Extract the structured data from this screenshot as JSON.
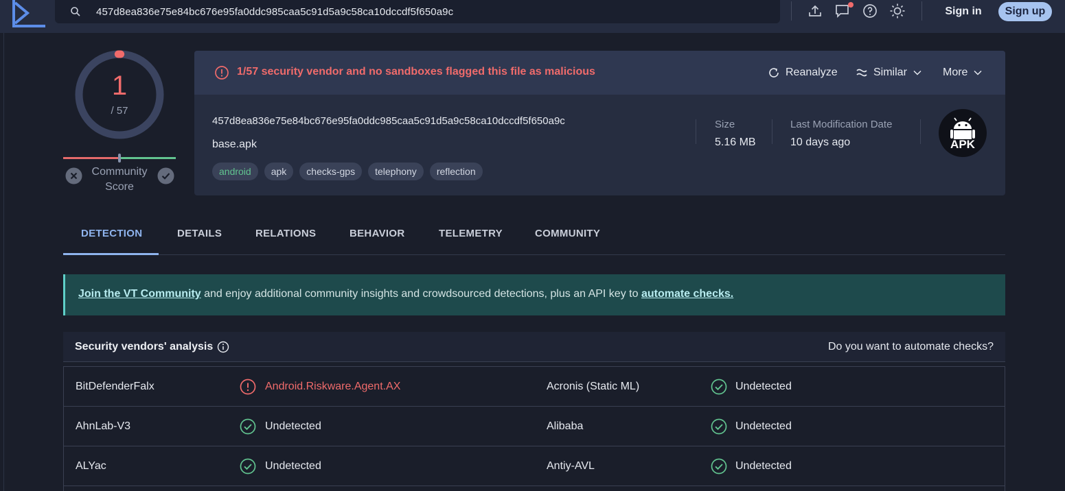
{
  "search": {
    "query": "457d8ea836e75e84bc676e95fa0ddc985caa5c91d5a9c58ca10dccdf5f650a9c"
  },
  "header": {
    "sign_in": "Sign in",
    "sign_up": "Sign up"
  },
  "score": {
    "detections": "1",
    "total": "/ 57",
    "community_label_1": "Community",
    "community_label_2": "Score",
    "detections_value": 1,
    "total_value": 57
  },
  "file": {
    "alert": "1/57 security vendor and no sandboxes flagged this file as malicious",
    "actions": {
      "reanalyze": "Reanalyze",
      "similar": "Similar",
      "more": "More"
    },
    "hash": "457d8ea836e75e84bc676e95fa0ddc985caa5c91d5a9c58ca10dccdf5f650a9c",
    "name": "base.apk",
    "tags": [
      "android",
      "apk",
      "checks-gps",
      "telephony",
      "reflection"
    ],
    "size_label": "Size",
    "size_value": "5.16 MB",
    "date_label": "Last Modification Date",
    "date_value": "10 days ago",
    "type_badge": "APK"
  },
  "tabs": [
    "DETECTION",
    "DETAILS",
    "RELATIONS",
    "BEHAVIOR",
    "TELEMETRY",
    "COMMUNITY"
  ],
  "banner": {
    "link1": "Join the VT Community",
    "middle": " and enjoy additional community insights and crowdsourced detections, plus an API key to ",
    "link2": "automate checks."
  },
  "vendors": {
    "title": "Security vendors' analysis",
    "automate": "Do you want to automate checks?",
    "rows": [
      {
        "left_name": "BitDefenderFalx",
        "left_result": "Android.Riskware.Agent.AX",
        "left_status": "malicious",
        "right_name": "Acronis (Static ML)",
        "right_result": "Undetected",
        "right_status": "undetected"
      },
      {
        "left_name": "AhnLab-V3",
        "left_result": "Undetected",
        "left_status": "undetected",
        "right_name": "Alibaba",
        "right_result": "Undetected",
        "right_status": "undetected"
      },
      {
        "left_name": "ALYac",
        "left_result": "Undetected",
        "left_status": "undetected",
        "right_name": "Antiy-AVL",
        "right_result": "Undetected",
        "right_status": "undetected"
      }
    ]
  },
  "colors": {
    "malicious": "#f06b6b",
    "undetected": "#62c490",
    "accent": "#8fb4ee"
  },
  "icons": [
    "virustotal-logo",
    "search-icon",
    "upload-icon",
    "chat-icon",
    "help-icon",
    "theme-icon",
    "alert-circle-icon",
    "reanalyze-icon",
    "similar-icon",
    "chevron-down-icon",
    "android-icon",
    "info-icon",
    "check-circle-icon",
    "close-circle-icon"
  ]
}
